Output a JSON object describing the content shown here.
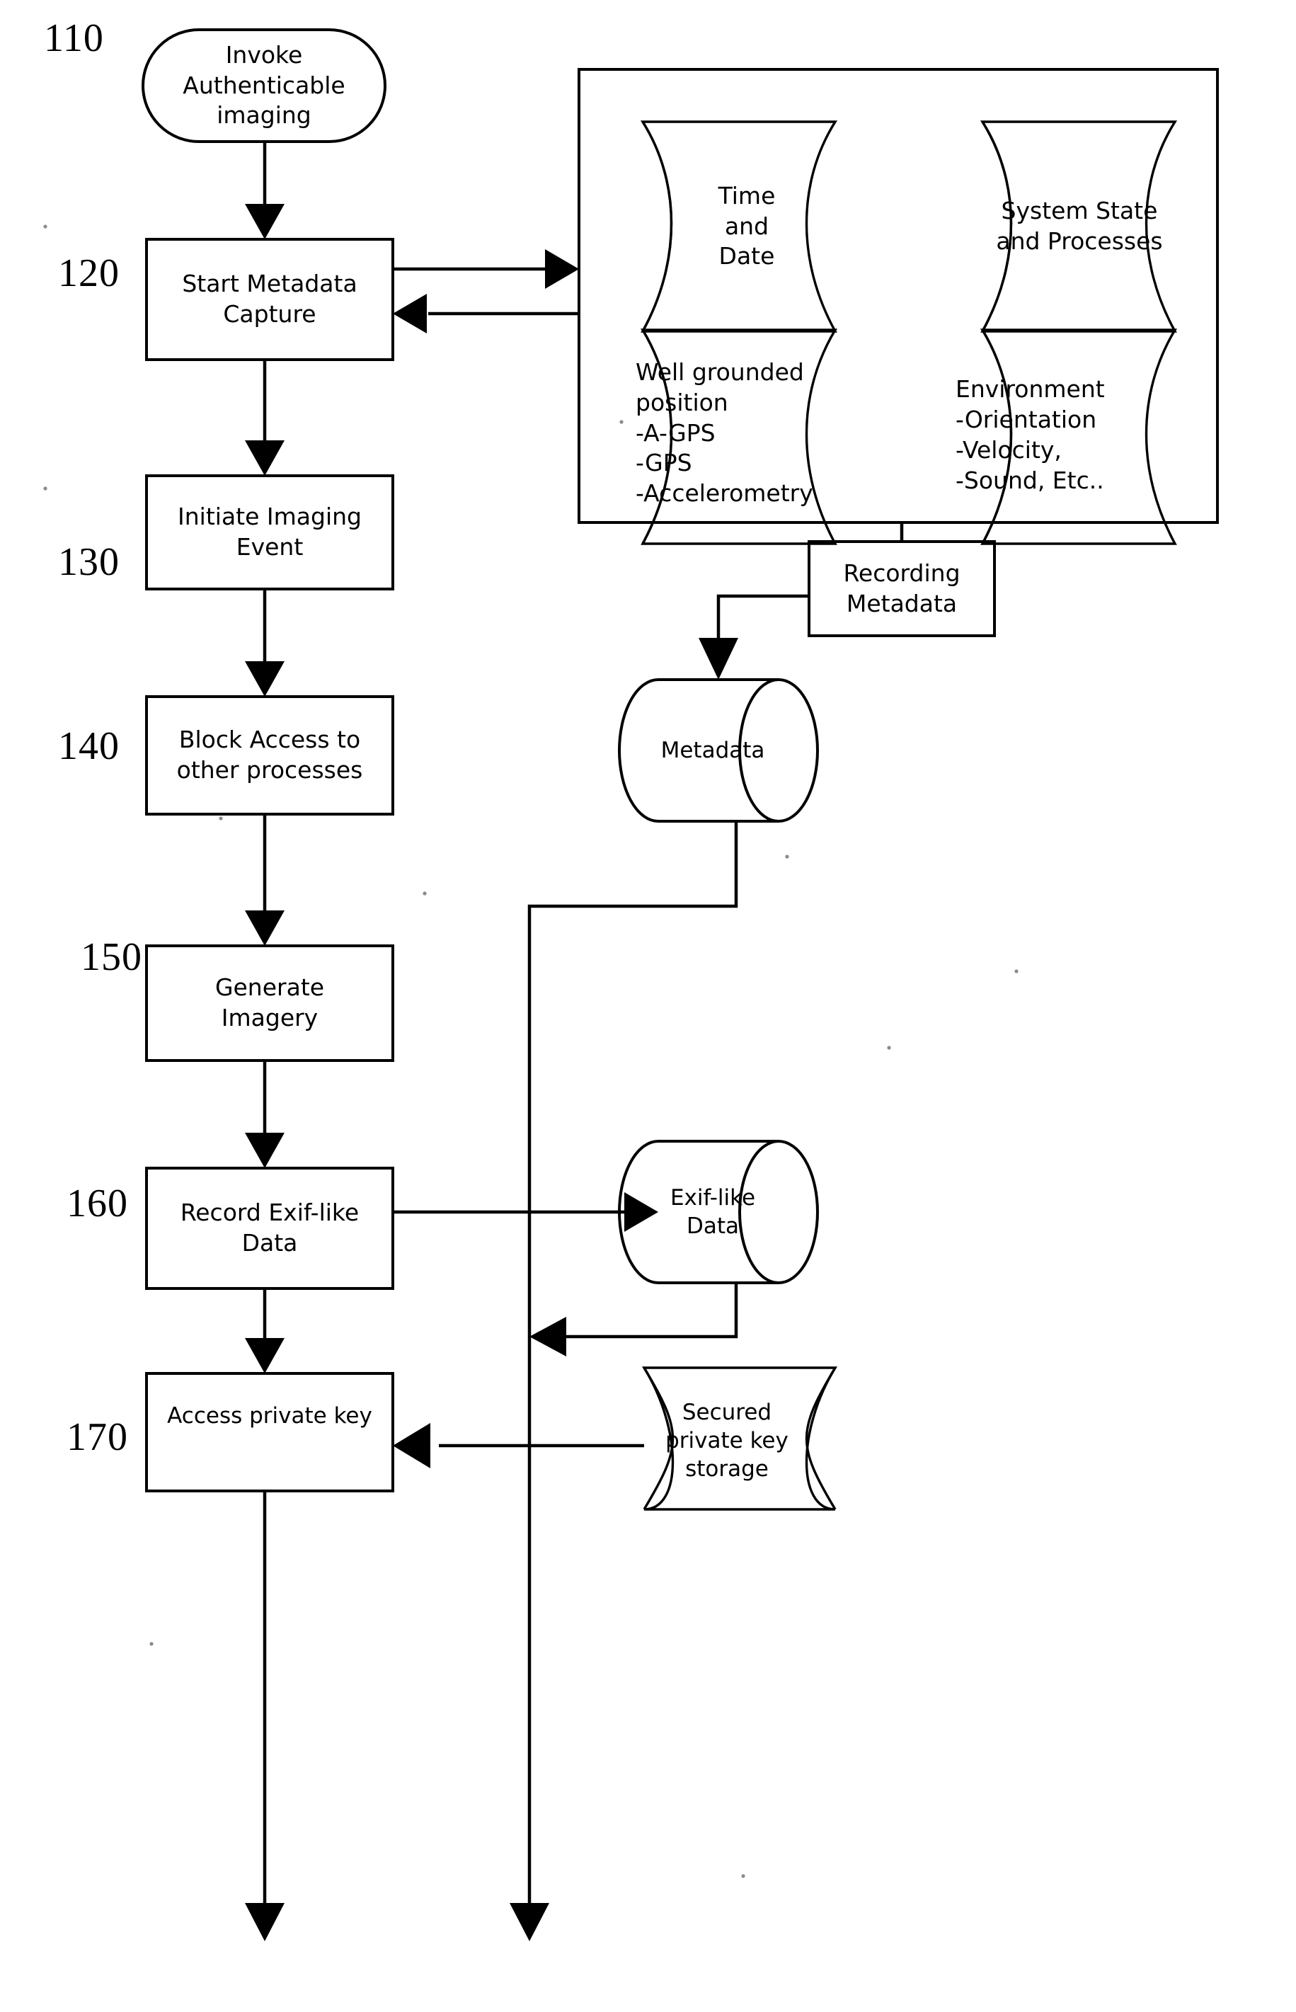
{
  "figure": {
    "title": "Authenticable imaging metadata capture flowchart",
    "line_color": "#000000",
    "background_color": "#ffffff"
  },
  "reference_numerals": [
    {
      "id": "110",
      "label": "110"
    },
    {
      "id": "120",
      "label": "120"
    },
    {
      "id": "130",
      "label": "130"
    },
    {
      "id": "140",
      "label": "140"
    },
    {
      "id": "150",
      "label": "150"
    },
    {
      "id": "160",
      "label": "160"
    },
    {
      "id": "170",
      "label": "170"
    }
  ],
  "process_nodes": [
    {
      "id": "invoke",
      "shape": "rounded-terminator",
      "label": "Invoke\nAuthenticable\nimaging"
    },
    {
      "id": "start-capture",
      "shape": "rectangle",
      "label": "Start Metadata\nCapture"
    },
    {
      "id": "initiate",
      "shape": "rectangle",
      "label": "Initiate Imaging\nEvent"
    },
    {
      "id": "block-access",
      "shape": "rectangle",
      "label": "Block Access to\nother processes"
    },
    {
      "id": "generate",
      "shape": "rectangle",
      "label": "Generate\nImagery"
    },
    {
      "id": "record-exif",
      "shape": "rectangle",
      "label": "Record Exif-like\nData"
    },
    {
      "id": "access-key",
      "shape": "rectangle",
      "label": "Access private key"
    },
    {
      "id": "recording",
      "shape": "rectangle",
      "label": "Recording\nMetadata"
    }
  ],
  "metadata_group": {
    "id": "metadata-sources-group",
    "sources": [
      {
        "id": "time-and-date",
        "shape": "curved-document",
        "label": "Time\nand\nDate",
        "align": "center"
      },
      {
        "id": "system-state",
        "shape": "curved-document",
        "label": "System State\nand Processes",
        "align": "center"
      },
      {
        "id": "well-grounded-pos",
        "shape": "curved-document",
        "label": "Well grounded\nposition\n-A-GPS\n-GPS\n-Accelerometry",
        "align": "left"
      },
      {
        "id": "environment",
        "shape": "curved-document",
        "label": "Environment\n-Orientation\n-Velocity,\n-Sound, Etc..",
        "align": "left"
      }
    ]
  },
  "data_stores": [
    {
      "id": "metadata-store",
      "shape": "cylinder",
      "label": "Metadata"
    },
    {
      "id": "exif-store",
      "shape": "cylinder",
      "label": "Exif-like\nData"
    },
    {
      "id": "key-store",
      "shape": "curved-document",
      "label": "Secured\nprivate key\nstorage"
    }
  ]
}
